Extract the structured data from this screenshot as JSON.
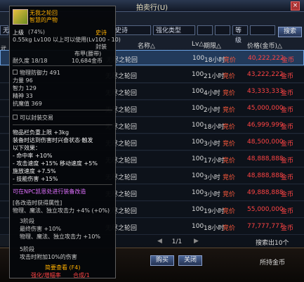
{
  "window": {
    "title": "拍卖行(U)",
    "close": "×"
  },
  "filters": {
    "field1": "无",
    "field2": "史诗",
    "field3": "强化类型",
    "field4": "",
    "field5": "",
    "field6": "",
    "field7": "等级",
    "search_button": "搜索"
  },
  "table": {
    "headers": {
      "name": "名称△",
      "level": "Lv△",
      "period": "期限△",
      "price": "价格(金币)△"
    },
    "rows": [
      {
        "name": "无尽之轮回",
        "level": "100",
        "time": "18小时",
        "bid": "竞价",
        "price": "40,222,222",
        "currency": "金币"
      },
      {
        "name": "无尽之轮回",
        "level": "100",
        "time": "21小时",
        "bid": "竞价",
        "price": "43,222,222",
        "currency": "金币"
      },
      {
        "name": "无尽之轮回",
        "level": "100",
        "time": "4小时",
        "bid": "竞价",
        "price": "43,333,333",
        "currency": "金币"
      },
      {
        "name": "无尽之轮回",
        "level": "100",
        "time": "2小时",
        "bid": "竞价",
        "price": "45,000,000",
        "currency": "金币"
      },
      {
        "name": "无尽之轮回",
        "level": "100",
        "time": "18小时",
        "bid": "竞价",
        "price": "46,999,999",
        "currency": "金币"
      },
      {
        "name": "无尽之轮回",
        "level": "100",
        "time": "3小时",
        "bid": "竞价",
        "price": "48,500,000",
        "currency": "金币"
      },
      {
        "name": "无尽之轮回",
        "level": "100",
        "time": "17小时",
        "bid": "竞价",
        "price": "48,888,888",
        "currency": "金币"
      },
      {
        "name": "无尽之轮回",
        "level": "100",
        "time": "3小时",
        "bid": "竞价",
        "price": "48,888,888",
        "currency": "金币"
      },
      {
        "name": "无尽之轮回",
        "level": "100",
        "time": "3小时",
        "bid": "竞价",
        "price": "49,888,888",
        "currency": "金币"
      },
      {
        "name": "无尽之轮回",
        "level": "100",
        "time": "19小时",
        "bid": "竞价",
        "price": "55,000,000",
        "currency": "金币"
      },
      {
        "name": "无尽之轮回",
        "level": "100",
        "time": "18小时",
        "bid": "竞价",
        "price": "77,777,777",
        "currency": "金币"
      }
    ]
  },
  "pager": {
    "text": "1/1"
  },
  "search_count": "搜索出10个",
  "bottom": {
    "buy": "购买",
    "close": "关闭",
    "gold_label": "所持金币"
  },
  "tooltip": {
    "name": "无我之轮回",
    "type": "智慧的产物",
    "grade": "上级",
    "grade_pct": "(74%)",
    "rarity": "史诗",
    "weight": "0.55kg Lv100 以上可以使用(Lv100 - 10)",
    "seal": "封装",
    "seal_sub": "布甲(腰带)",
    "durability": "耐久度 18/18",
    "price": "10,684金币",
    "stat_pdef": "物理防御力 491",
    "stat_str": "力量 96",
    "stat_int": "智力 129",
    "stat_spirit": "精神 33",
    "stat_resist": "抗魔值 369",
    "tradable": "可以封装交易",
    "bonus1": "物品栏负重上限 +3kg",
    "bonus2": "装备时达到伤害时兴奋状态·触发",
    "bonus3": "以下效果：",
    "bonus4": "- 命中率 +10%",
    "bonus5": "- 攻击速度 +15% 移动速度 +5%",
    "bonus6": "施放速度 +7.5%",
    "bonus7": "- 技能伤害 +15%",
    "notice": "可在NPC凯恩处进行装备改造",
    "set_title": "[各改造时获得属性]",
    "set1": "物理、魔法、独立攻击力 +4% (+0%)",
    "set_sub": "3阶段",
    "set2": "最终伤害 +10%",
    "set3": "物理、魔法、独立攻击力 +10%",
    "set_sub2": "5阶段",
    "set4": "攻击时附加10%的伤害",
    "footer": "简要查看 (F4)",
    "footer_l": "强化/增幅率",
    "footer_r": "合成/1"
  },
  "colors": {
    "price_red": "#ff4444",
    "epic_orange": "#ffb000",
    "purple": "#e070ff"
  }
}
